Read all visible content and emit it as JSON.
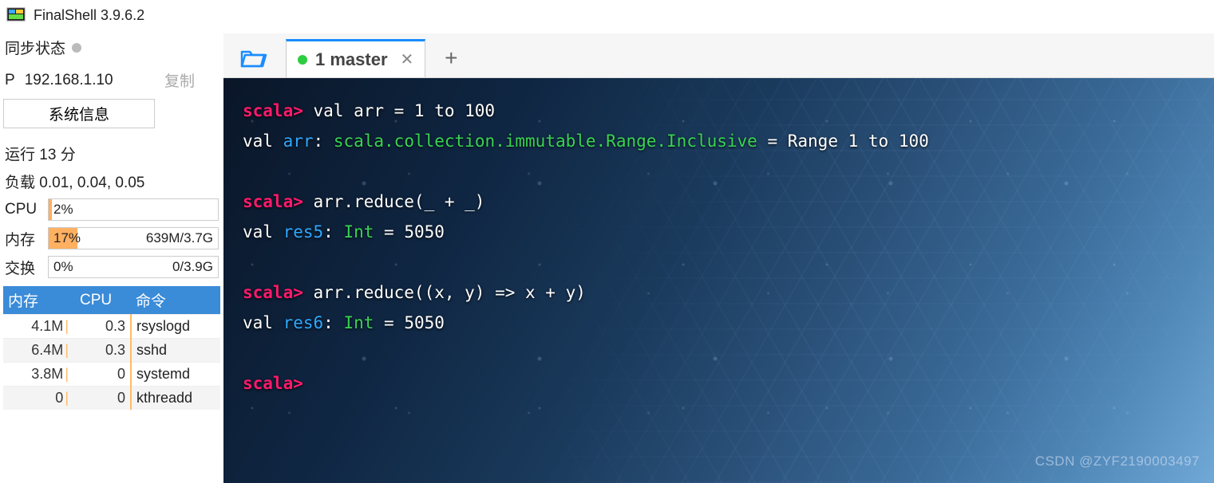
{
  "app_title": "FinalShell 3.9.6.2",
  "sync_label": "同步状态",
  "ip_label": "P",
  "ip_value": "192.168.1.10",
  "copy_label": "复制",
  "sysinfo_button": "系统信息",
  "uptime_label": "运行",
  "uptime_value": "13 分",
  "load_label": "负载",
  "load_value": "0.01, 0.04, 0.05",
  "cpu": {
    "label": "CPU",
    "pct": "2%",
    "fill": 2,
    "extra": ""
  },
  "mem": {
    "label": "内存",
    "pct": "17%",
    "fill": 17,
    "extra": "639M/3.7G"
  },
  "swap": {
    "label": "交换",
    "pct": "0%",
    "fill": 0,
    "extra": "0/3.9G"
  },
  "proc_headers": {
    "mem": "内存",
    "cpu": "CPU",
    "cmd": "命令"
  },
  "procs": [
    {
      "mem": "4.1M",
      "cpu": "0.3",
      "cmd": "rsyslogd"
    },
    {
      "mem": "6.4M",
      "cpu": "0.3",
      "cmd": "sshd"
    },
    {
      "mem": "3.8M",
      "cpu": "0",
      "cmd": "systemd"
    },
    {
      "mem": "0",
      "cpu": "0",
      "cmd": "kthreadd"
    }
  ],
  "tab": {
    "label": "1 master"
  },
  "terminal": {
    "prompt": "scala>",
    "lines": [
      {
        "prompt": true,
        "spans": [
          [
            "t-txt",
            " val arr = 1 to 100"
          ]
        ]
      },
      {
        "prompt": false,
        "spans": [
          [
            "t-kw",
            "val "
          ],
          [
            "t-var",
            "arr"
          ],
          [
            "t-txt",
            ": "
          ],
          [
            "t-type",
            "scala.collection.immutable.Range.Inclusive"
          ],
          [
            "t-txt",
            " = Range 1 to 100"
          ]
        ]
      },
      {
        "blank": true
      },
      {
        "prompt": true,
        "spans": [
          [
            "t-txt",
            " arr.reduce(_ + _)"
          ]
        ]
      },
      {
        "prompt": false,
        "spans": [
          [
            "t-kw",
            "val "
          ],
          [
            "t-var",
            "res5"
          ],
          [
            "t-txt",
            ": "
          ],
          [
            "t-type",
            "Int"
          ],
          [
            "t-txt",
            " = 5050"
          ]
        ]
      },
      {
        "blank": true
      },
      {
        "prompt": true,
        "spans": [
          [
            "t-txt",
            " arr.reduce((x, y) => x + y)"
          ]
        ]
      },
      {
        "prompt": false,
        "spans": [
          [
            "t-kw",
            "val "
          ],
          [
            "t-var",
            "res6"
          ],
          [
            "t-txt",
            ": "
          ],
          [
            "t-type",
            "Int"
          ],
          [
            "t-txt",
            " = 5050"
          ]
        ]
      },
      {
        "blank": true
      },
      {
        "prompt": true,
        "spans": []
      }
    ]
  },
  "watermark": "CSDN @ZYF2190003497"
}
